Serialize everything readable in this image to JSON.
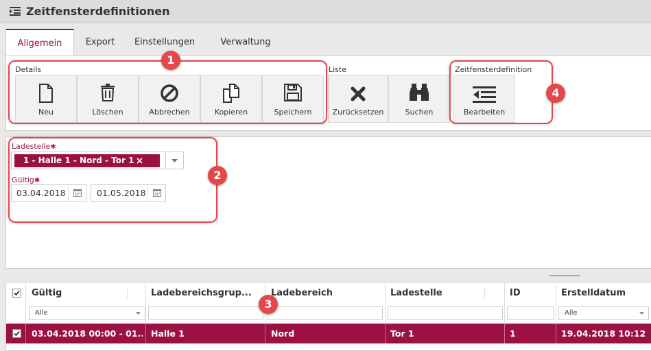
{
  "app": {
    "title": "Zeitfensterdefinitionen",
    "title_icon": "list-indent-icon"
  },
  "tabs": [
    {
      "label": "Allgemein",
      "active": true
    },
    {
      "label": "Export",
      "active": false
    },
    {
      "label": "Einstellungen",
      "active": false
    },
    {
      "label": "Verwaltung",
      "active": false
    }
  ],
  "toolbar": {
    "groups": {
      "details": "Details",
      "liste": "Liste",
      "zeitfenster": "Zeitfensterdefinition"
    },
    "buttons": {
      "neu": "Neu",
      "loeschen": "Löschen",
      "abbrechen": "Abbrechen",
      "kopieren": "Kopieren",
      "speichern": "Speichern",
      "zuruecksetzen": "Zurücksetzen",
      "suchen": "Suchen",
      "bearbeiten": "Bearbeiten"
    }
  },
  "form": {
    "ladestelle_label": "Ladestelle",
    "ladestelle_value": "1 - Halle 1 - Nord - Tor 1",
    "gueltig_label": "Gültig",
    "date_from": "03.04.2018",
    "date_to": "01.05.2018",
    "required_mark": "✱"
  },
  "grid": {
    "columns": [
      "Gültig",
      "Ladebereichsgrup...",
      "Ladebereich",
      "Ladestelle",
      "ID",
      "Erstelldatum"
    ],
    "filter_all": "Alle",
    "rows": [
      [
        "03.04.2018 00:00 - 01...",
        "Halle 1",
        "Nord",
        "Tor 1",
        "1",
        "19.04.2018 10:12"
      ]
    ]
  },
  "callouts": [
    "1",
    "2",
    "3",
    "4"
  ],
  "colors": {
    "accent": "#9b1143",
    "callout": "#e5474b"
  }
}
